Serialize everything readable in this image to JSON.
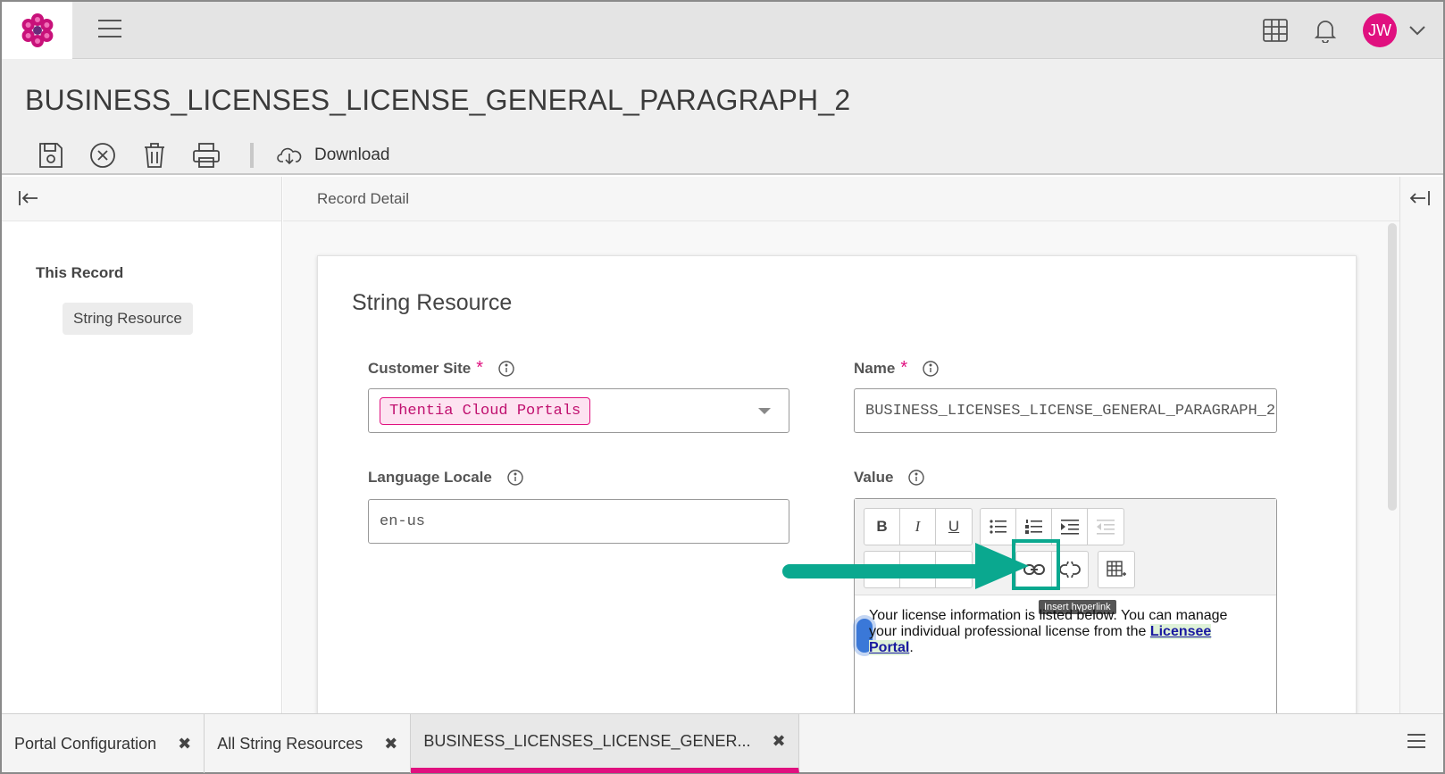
{
  "page": {
    "title": "BUSINESS_LICENSES_LICENSE_GENERAL_PARAGRAPH_2"
  },
  "topbar": {
    "avatar_initials": "JW",
    "brand_color": "#e0107f"
  },
  "toolbar": {
    "download_label": "Download"
  },
  "breadcrumb": "Record Detail",
  "nav": {
    "section": "This Record",
    "items": [
      {
        "label": "String Resource"
      }
    ]
  },
  "form": {
    "title": "String Resource",
    "customer_site": {
      "label": "Customer Site",
      "value": "Thentia Cloud Portals"
    },
    "name": {
      "label": "Name",
      "value": "BUSINESS_LICENSES_LICENSE_GENERAL_PARAGRAPH_2"
    },
    "language_locale": {
      "label": "Language Locale",
      "value": "en-us"
    },
    "value": {
      "label": "Value",
      "text_before": "Your license information is listed below. You can manage your individual professional license from the ",
      "link_text": "Licensee Portal",
      "text_after": "."
    }
  },
  "editor": {
    "tooltip": "Insert hyperlink",
    "buttons_row1": [
      "B",
      "I",
      "U"
    ],
    "accent": "#0aa88f"
  },
  "tabs": [
    {
      "label": "Portal Configuration",
      "close": "✖"
    },
    {
      "label": "All String Resources",
      "close": "✖"
    },
    {
      "label": "BUSINESS_LICENSES_LICENSE_GENER...",
      "close": "✖"
    }
  ]
}
